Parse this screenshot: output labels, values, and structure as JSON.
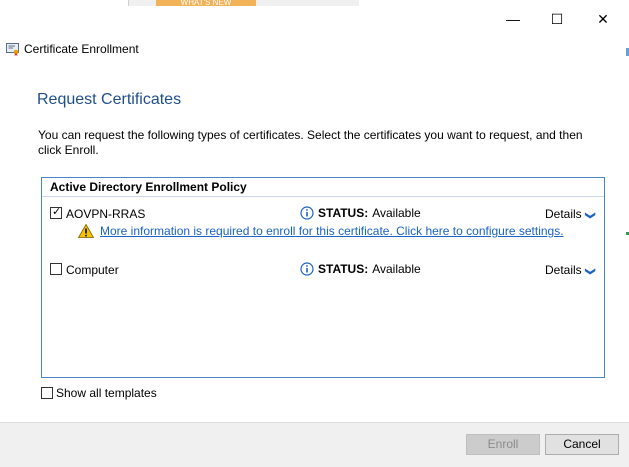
{
  "background": {
    "tab_label": "WHAT'S NEW"
  },
  "window": {
    "title": "Certificate Enrollment",
    "minimize_glyph": "—",
    "maximize_glyph": "☐",
    "close_glyph": "✕"
  },
  "heading": "Request Certificates",
  "intro": "You can request the following types of certificates. Select the certificates you want to request, and then click Enroll.",
  "policy": {
    "title": "Active Directory Enrollment Policy",
    "certificates": [
      {
        "name": "AOVPN-RRAS",
        "checked": true,
        "status_label": "STATUS:",
        "status_value": "Available",
        "details_label": "Details",
        "warning": "More information is required to enroll for this certificate. Click here to configure settings."
      },
      {
        "name": "Computer",
        "checked": false,
        "status_label": "STATUS:",
        "status_value": "Available",
        "details_label": "Details"
      }
    ]
  },
  "show_all_templates": {
    "label": "Show all templates",
    "checked": false
  },
  "footer": {
    "enroll_label": "Enroll",
    "cancel_label": "Cancel"
  },
  "colors": {
    "accent": "#1a63c8",
    "heading": "#1f4e8c",
    "border": "#4a86c5",
    "warning": "#f4c400"
  },
  "icons": [
    "certificate-icon",
    "info-icon",
    "warning-icon",
    "chevron-down-icon",
    "checkmark-icon"
  ]
}
